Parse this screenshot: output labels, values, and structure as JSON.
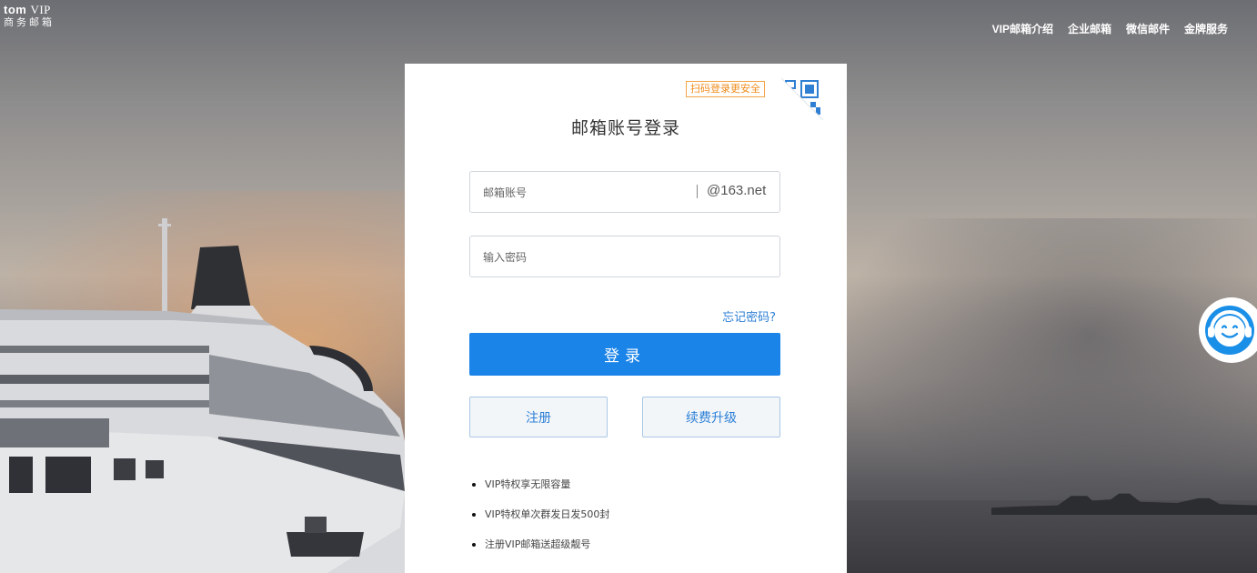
{
  "logo": {
    "brand": "tom",
    "tier": "VIP",
    "subtitle": "商务邮箱"
  },
  "top_nav": [
    {
      "label": "VIP邮箱介绍"
    },
    {
      "label": "企业邮箱"
    },
    {
      "label": "微信邮件"
    },
    {
      "label": "金牌服务"
    }
  ],
  "login": {
    "qr_hint": "扫码登录更安全",
    "title": "邮箱账号登录",
    "email_placeholder": "邮箱账号",
    "email_value": "",
    "email_domain": "@163.net",
    "password_placeholder": "输入密码",
    "password_value": "",
    "forgot_label": "忘记密码?",
    "submit_label": "登录",
    "register_label": "注册",
    "renew_label": "续费升级"
  },
  "features": [
    "VIP特权享无限容量",
    "VIP特权单次群发日发500封",
    "注册VIP邮箱送超级靓号"
  ],
  "colors": {
    "primary": "#1b84e8",
    "link": "#2e7fd6",
    "qr_hint": "#f08c1e",
    "secondary_bg": "#f3f6f9"
  },
  "icons": {
    "qr": "qr-code-icon",
    "service": "customer-service-icon"
  }
}
